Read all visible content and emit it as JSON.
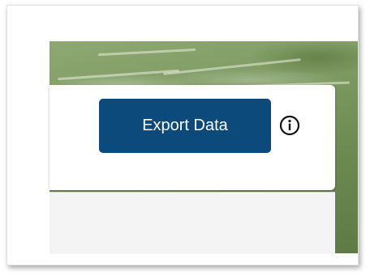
{
  "toolbar": {
    "export_label": "Export Data",
    "info_icon": "info-icon"
  },
  "colors": {
    "button_bg": "#0d4a7c",
    "button_text": "#ffffff",
    "map_green": "#7e9a62"
  }
}
